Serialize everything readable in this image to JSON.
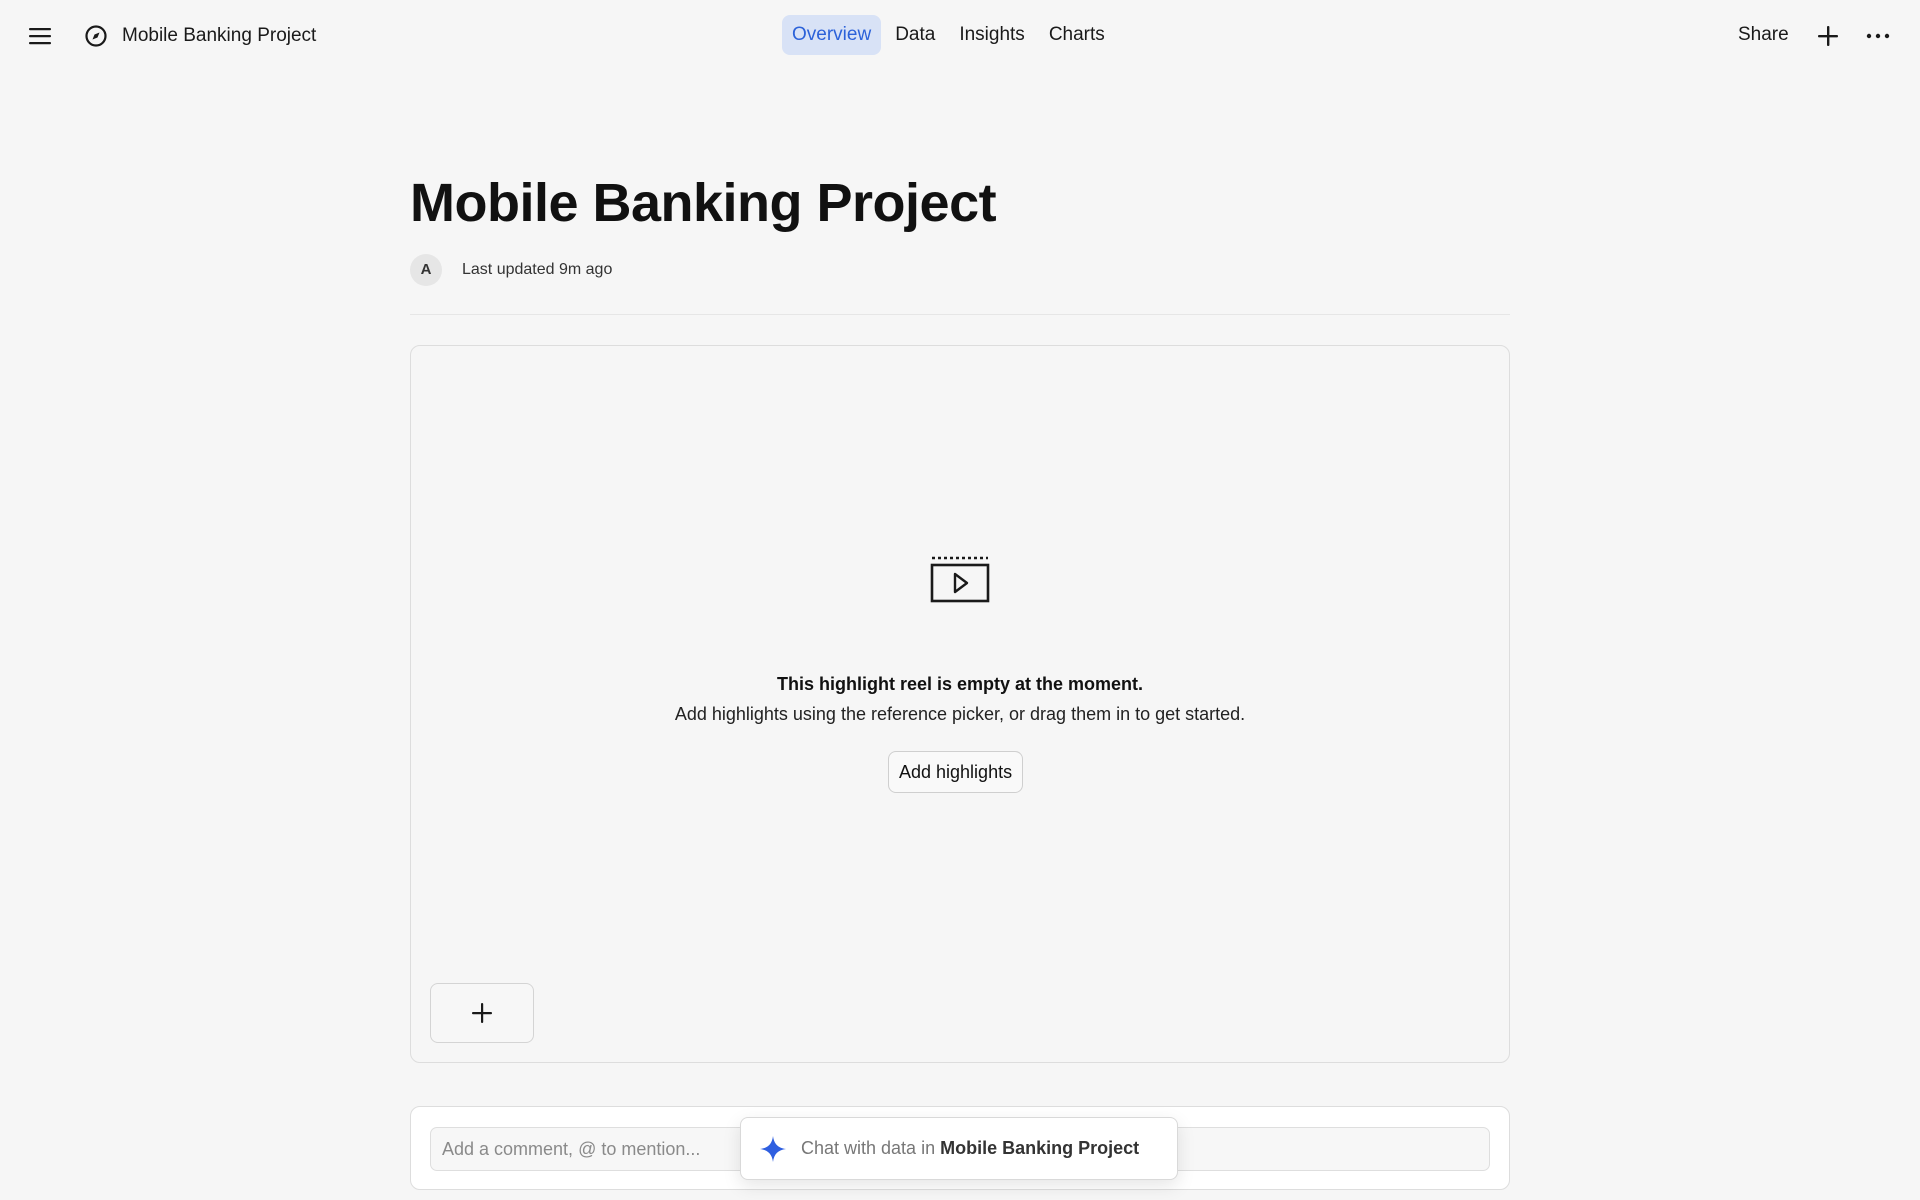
{
  "header": {
    "project_name": "Mobile Banking Project",
    "tabs": [
      {
        "label": "Overview",
        "active": true
      },
      {
        "label": "Data",
        "active": false
      },
      {
        "label": "Insights",
        "active": false
      },
      {
        "label": "Charts",
        "active": false
      }
    ],
    "share_label": "Share",
    "icons": [
      "menu-icon",
      "compass-icon",
      "plus-icon",
      "more-icon"
    ]
  },
  "page": {
    "title": "Mobile Banking Project",
    "avatar_initial": "A",
    "last_updated": "Last updated 9m ago"
  },
  "reel": {
    "empty_title": "This highlight reel is empty at the moment.",
    "empty_subtitle": "Add highlights using the reference picker, or drag them in to get started.",
    "add_button": "Add highlights"
  },
  "comment": {
    "placeholder": "Add a comment, @ to mention..."
  },
  "chat": {
    "prefix": "Chat with data in ",
    "project": "Mobile Banking Project"
  },
  "colors": {
    "background": "#f6f6f6",
    "active_tab_bg": "#d8e2f6",
    "active_tab_text": "#2c62d9",
    "sparkle": "#2f5fe0"
  }
}
